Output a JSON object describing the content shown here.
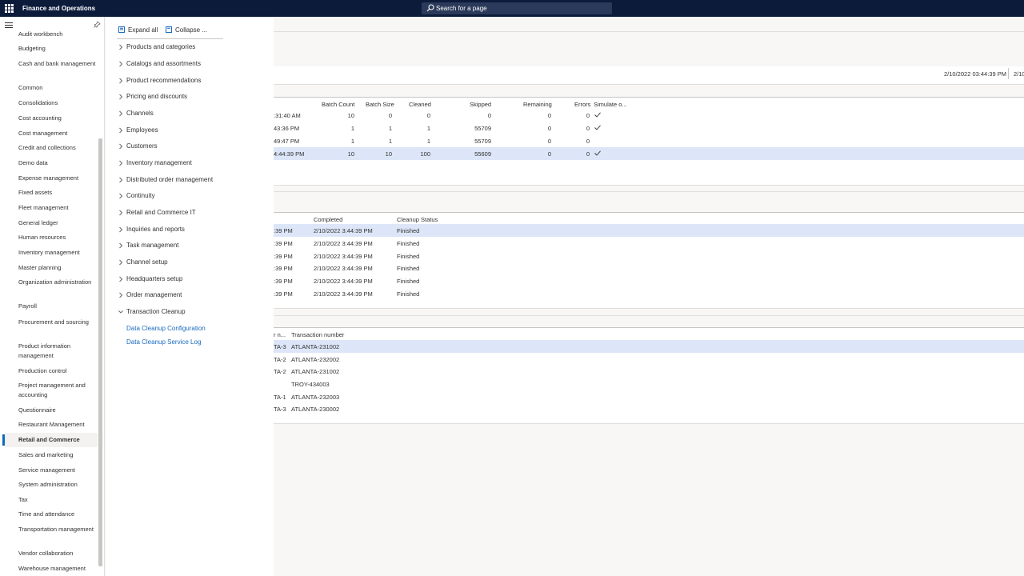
{
  "app": {
    "title": "Finance and Operations",
    "search_placeholder": "Search for a page"
  },
  "modules": [
    {
      "label": "Audit workbench"
    },
    {
      "label": "Budgeting"
    },
    {
      "label": "Cash and bank management"
    },
    {
      "label": "Common"
    },
    {
      "label": "Consolidations"
    },
    {
      "label": "Cost accounting"
    },
    {
      "label": "Cost management"
    },
    {
      "label": "Credit and collections"
    },
    {
      "label": "Demo data"
    },
    {
      "label": "Expense management"
    },
    {
      "label": "Fixed assets"
    },
    {
      "label": "Fleet management"
    },
    {
      "label": "General ledger"
    },
    {
      "label": "Human resources"
    },
    {
      "label": "Inventory management"
    },
    {
      "label": "Master planning"
    },
    {
      "label": "Organization administration"
    },
    {
      "label": "Payroll"
    },
    {
      "label": "Procurement and sourcing"
    },
    {
      "label": "Product information management"
    },
    {
      "label": "Production control"
    },
    {
      "label": "Project management and accounting"
    },
    {
      "label": "Questionnaire"
    },
    {
      "label": "Restaurant Management"
    },
    {
      "label": "Retail and Commerce",
      "active": true
    },
    {
      "label": "Sales and marketing"
    },
    {
      "label": "Service management"
    },
    {
      "label": "System administration"
    },
    {
      "label": "Tax"
    },
    {
      "label": "Time and attendance"
    },
    {
      "label": "Transportation management"
    },
    {
      "label": "Vendor collaboration"
    },
    {
      "label": "Warehouse management"
    }
  ],
  "flyout": {
    "expand_all": "Expand all",
    "collapse": "Collapse ...",
    "nodes": [
      {
        "label": "Products and categories"
      },
      {
        "label": "Catalogs and assortments"
      },
      {
        "label": "Product recommendations"
      },
      {
        "label": "Pricing and discounts"
      },
      {
        "label": "Channels"
      },
      {
        "label": "Employees"
      },
      {
        "label": "Customers"
      },
      {
        "label": "Inventory management"
      },
      {
        "label": "Distributed order management"
      },
      {
        "label": "Continuity"
      },
      {
        "label": "Retail and Commerce IT"
      },
      {
        "label": "Inquiries and reports"
      },
      {
        "label": "Task management"
      },
      {
        "label": "Channel setup"
      },
      {
        "label": "Headquarters setup"
      },
      {
        "label": "Order management"
      },
      {
        "label": "Transaction Cleanup",
        "expanded": true
      }
    ],
    "links": [
      {
        "label": "Data Cleanup Configuration"
      },
      {
        "label": "Data Cleanup Service Log"
      }
    ]
  },
  "main": {
    "timestamp1": "2/10/2022 03:44:39 PM",
    "timestamp2": "2/10",
    "grid1": {
      "headers": {
        "batch_count": "Batch Count",
        "batch_size": "Batch Size",
        "cleaned": "Cleaned",
        "skipped": "Skipped",
        "remaining": "Remaining",
        "errors": "Errors",
        "simulate": "Simulate o..."
      },
      "rows": [
        {
          "time": ":31:40 AM",
          "batch_count": "10",
          "batch_size": "0",
          "cleaned": "0",
          "skipped": "0",
          "remaining": "0",
          "errors": "0",
          "simulate": true
        },
        {
          "time": "43:36 PM",
          "batch_count": "1",
          "batch_size": "1",
          "cleaned": "1",
          "skipped": "55709",
          "remaining": "0",
          "errors": "0",
          "simulate": true
        },
        {
          "time": "49:47 PM",
          "batch_count": "1",
          "batch_size": "1",
          "cleaned": "1",
          "skipped": "55709",
          "remaining": "0",
          "errors": "0",
          "simulate": false
        },
        {
          "time": "4:44:39 PM",
          "batch_count": "10",
          "batch_size": "10",
          "cleaned": "100",
          "skipped": "55609",
          "remaining": "0",
          "errors": "0",
          "simulate": true,
          "selected": true
        }
      ]
    },
    "grid2": {
      "headers": {
        "completed": "Completed",
        "status": "Cleanup Status"
      },
      "rows": [
        {
          "start": ":39 PM",
          "completed": "2/10/2022 3:44:39 PM",
          "status": "Finished",
          "selected": true
        },
        {
          "start": ":39 PM",
          "completed": "2/10/2022 3:44:39 PM",
          "status": "Finished"
        },
        {
          "start": ":39 PM",
          "completed": "2/10/2022 3:44:39 PM",
          "status": "Finished"
        },
        {
          "start": ":39 PM",
          "completed": "2/10/2022 3:44:39 PM",
          "status": "Finished"
        },
        {
          "start": ":39 PM",
          "completed": "2/10/2022 3:44:39 PM",
          "status": "Finished"
        },
        {
          "start": ":39 PM",
          "completed": "2/10/2022 3:44:39 PM",
          "status": "Finished"
        }
      ]
    },
    "grid3": {
      "headers": {
        "register": "r n...",
        "transaction": "Transaction number"
      },
      "rows": [
        {
          "register": "TA-3",
          "transaction": "ATLANTA-231002",
          "selected": true
        },
        {
          "register": "TA-2",
          "transaction": "ATLANTA-232002"
        },
        {
          "register": "TA-2",
          "transaction": "ATLANTA-231002"
        },
        {
          "register": "",
          "transaction": "TROY-434003"
        },
        {
          "register": "TA-1",
          "transaction": "ATLANTA-232003"
        },
        {
          "register": "TA-3",
          "transaction": "ATLANTA-230002"
        }
      ]
    }
  },
  "colors": {
    "topbar": "#0c1b3a",
    "accent": "#0f6cbd",
    "link": "#1a6bbf",
    "row_selected": "#dce6f8"
  }
}
